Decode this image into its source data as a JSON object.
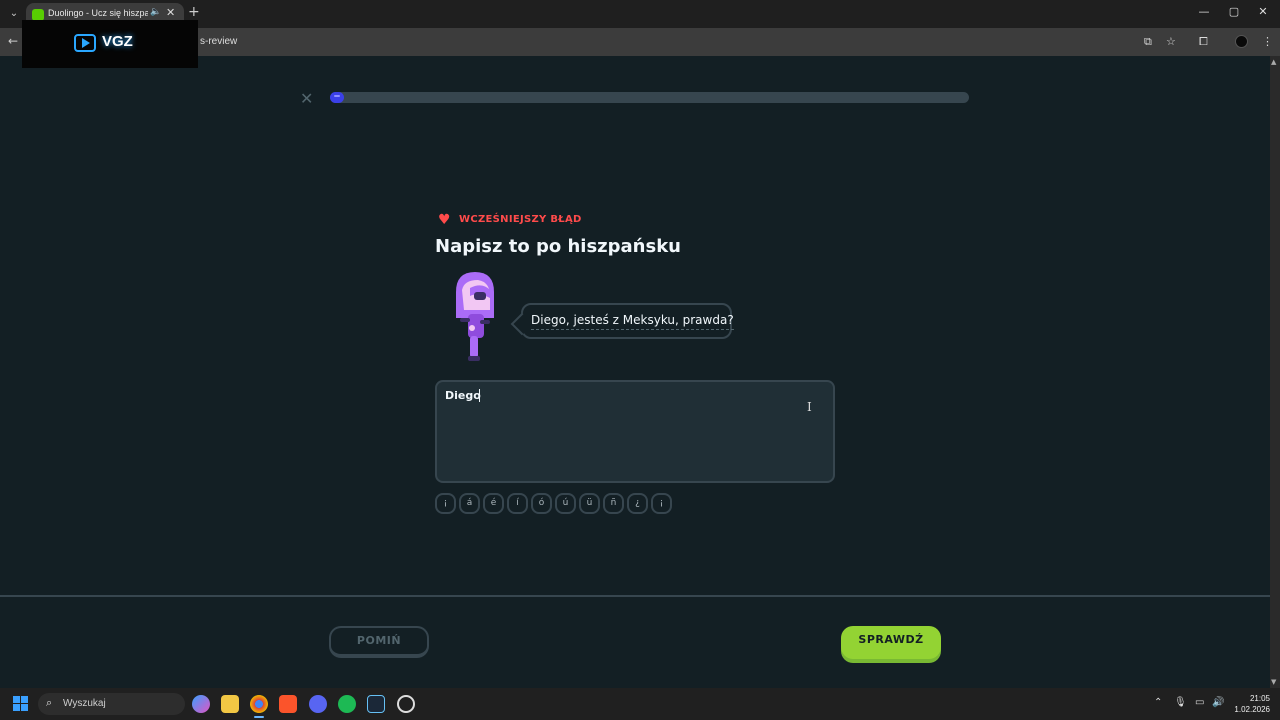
{
  "browser": {
    "tab_title": "Duolingo - Ucz się hiszpańskiego",
    "tab_close": "✕",
    "new_tab": "+",
    "url": "s-review",
    "window_controls": {
      "minimize": "—",
      "maximize": "▢",
      "close": "✕"
    }
  },
  "overlay": {
    "logo_text": "VGZ"
  },
  "lesson": {
    "close_icon": "✕",
    "progress_percent": 2,
    "mistake_label": "WCZEŚNIEJSZY BŁĄD",
    "prompt_title": "Napisz to po hiszpańsku",
    "sentence": "Diego, jesteś z Meksyku, prawda?",
    "answer_value": "Diego",
    "special_keys": [
      "¡",
      "á",
      "é",
      "í",
      "ó",
      "ú",
      "ü",
      "ñ",
      "¿",
      "¡"
    ],
    "skip_label": "POMIŃ",
    "check_label": "SPRAWDŹ"
  },
  "colors": {
    "background": "#131f24",
    "progress_fill": "#3b40e8",
    "mistake_red": "#ff4b4b",
    "check_green": "#93d333"
  },
  "taskbar": {
    "search_placeholder": "Wyszukaj",
    "time": "21:05",
    "date": "1.02.2026",
    "apps": [
      "copilot-icon",
      "file-explorer-icon",
      "chrome-icon",
      "brave-icon",
      "discord-icon",
      "spotify-icon",
      "steam-icon",
      "chatgpt-icon"
    ]
  }
}
